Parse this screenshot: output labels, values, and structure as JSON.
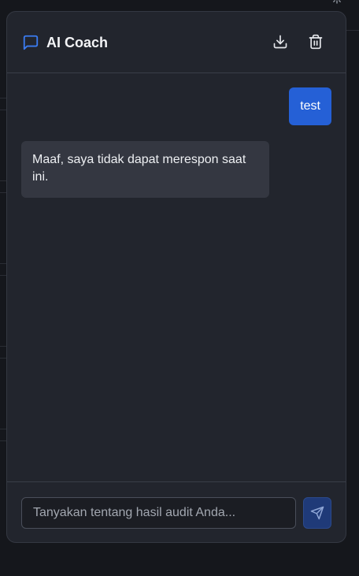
{
  "header": {
    "title": "AI Coach",
    "chat_icon": "message-square-icon",
    "download_icon": "download-icon",
    "delete_icon": "trash-icon"
  },
  "messages": [
    {
      "role": "user",
      "text": "test"
    },
    {
      "role": "assistant",
      "text": "Maaf, saya tidak dapat merespon saat ini."
    }
  ],
  "composer": {
    "placeholder": "Tanyakan tentang hasil audit Anda...",
    "value": "",
    "send_icon": "send-icon"
  },
  "colors": {
    "accent": "#2560d6",
    "panel_bg": "#22252d",
    "ai_bubble": "#343741"
  }
}
